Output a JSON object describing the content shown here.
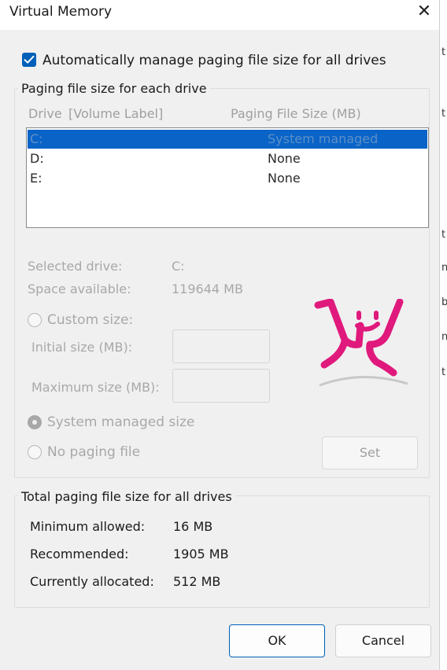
{
  "window": {
    "title": "Virtual Memory",
    "close_glyph": "✕"
  },
  "auto_manage": {
    "label": "Automatically manage paging file size for all drives",
    "checked": true
  },
  "drives_group": {
    "legend": "Paging file size for each drive",
    "col_drive": "Drive",
    "col_volume": "[Volume Label]",
    "col_size": "Paging File Size (MB)",
    "rows": [
      {
        "drive": "C:",
        "size": "System managed",
        "selected": true
      },
      {
        "drive": "D:",
        "size": "None",
        "selected": false
      },
      {
        "drive": "E:",
        "size": "None",
        "selected": false
      }
    ],
    "selected_drive_label": "Selected drive:",
    "selected_drive_value": "C:",
    "space_label": "Space available:",
    "space_value": "119644 MB",
    "custom_size_label": "Custom size:",
    "initial_label": "Initial size (MB):",
    "initial_value": "",
    "maximum_label": "Maximum size (MB):",
    "maximum_value": "",
    "system_managed_label": "System managed size",
    "no_paging_label": "No paging file",
    "set_label": "Set",
    "selected_option": "system_managed"
  },
  "totals_group": {
    "legend": "Total paging file size for all drives",
    "rows": [
      {
        "label": "Minimum allowed:",
        "value": "16 MB"
      },
      {
        "label": "Recommended:",
        "value": "1905 MB"
      },
      {
        "label": "Currently allocated:",
        "value": "512 MB"
      }
    ]
  },
  "buttons": {
    "ok": "OK",
    "cancel": "Cancel"
  },
  "colors": {
    "accent": "#005fb8",
    "selection": "#0a64c8",
    "logo": "#e0197d"
  },
  "icons": {
    "checkbox": "checkmark-icon",
    "logo": "smiley-figure-logo",
    "close": "close-icon"
  }
}
